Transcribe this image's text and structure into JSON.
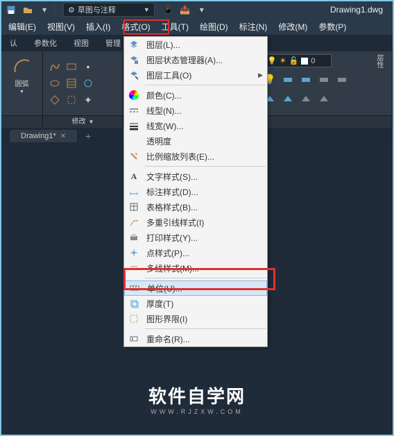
{
  "titlebar": {
    "workspace_label": "草图与注释",
    "document_title": "Drawing1.dwg"
  },
  "menubar": {
    "items": [
      "编辑(E)",
      "视图(V)",
      "插入(I)",
      "格式(O)",
      "工具(T)",
      "绘图(D)",
      "标注(N)",
      "修改(M)",
      "参数(P)"
    ]
  },
  "tabbar": {
    "items": [
      "认",
      "参数化",
      "视图",
      "管理"
    ]
  },
  "ribbon": {
    "arc_label": "圆弧",
    "modify_label": "修改",
    "layer_label": "图层",
    "layer_value": "0"
  },
  "doc_tabs": {
    "active": "Drawing1*"
  },
  "format_menu": {
    "items": [
      {
        "icon": "layers",
        "label": "图层(L)..."
      },
      {
        "icon": "layers-state",
        "label": "图层状态管理器(A)..."
      },
      {
        "icon": "layers-tools",
        "label": "图层工具(O)",
        "submenu": true
      },
      {
        "sep": true
      },
      {
        "icon": "colorwheel",
        "label": "颜色(C)..."
      },
      {
        "icon": "linetype",
        "label": "线型(N)..."
      },
      {
        "icon": "lineweight",
        "label": "线宽(W)..."
      },
      {
        "icon": "transparency",
        "label": "透明度"
      },
      {
        "icon": "scale-list",
        "label": "比例缩放列表(E)..."
      },
      {
        "sep": true
      },
      {
        "icon": "text-style",
        "label": "文字样式(S)..."
      },
      {
        "icon": "dim-style",
        "label": "标注样式(D)..."
      },
      {
        "icon": "table-style",
        "label": "表格样式(B)..."
      },
      {
        "icon": "mleader-style",
        "label": "多重引线样式(I)"
      },
      {
        "icon": "plot-style",
        "label": "打印样式(Y)..."
      },
      {
        "icon": "point-style",
        "label": "点样式(P)..."
      },
      {
        "icon": "mline-style",
        "label": "多线样式(M)..."
      },
      {
        "sep": true
      },
      {
        "icon": "units",
        "label": "单位(U)...",
        "selected": true
      },
      {
        "icon": "thickness",
        "label": "厚度(T)"
      },
      {
        "icon": "limits",
        "label": "图形界限(I)"
      },
      {
        "sep": true
      },
      {
        "icon": "rename",
        "label": "重命名(R)..."
      }
    ]
  },
  "watermark": {
    "main": "软件自学网",
    "sub": "WWW.RJZXW.COM"
  }
}
